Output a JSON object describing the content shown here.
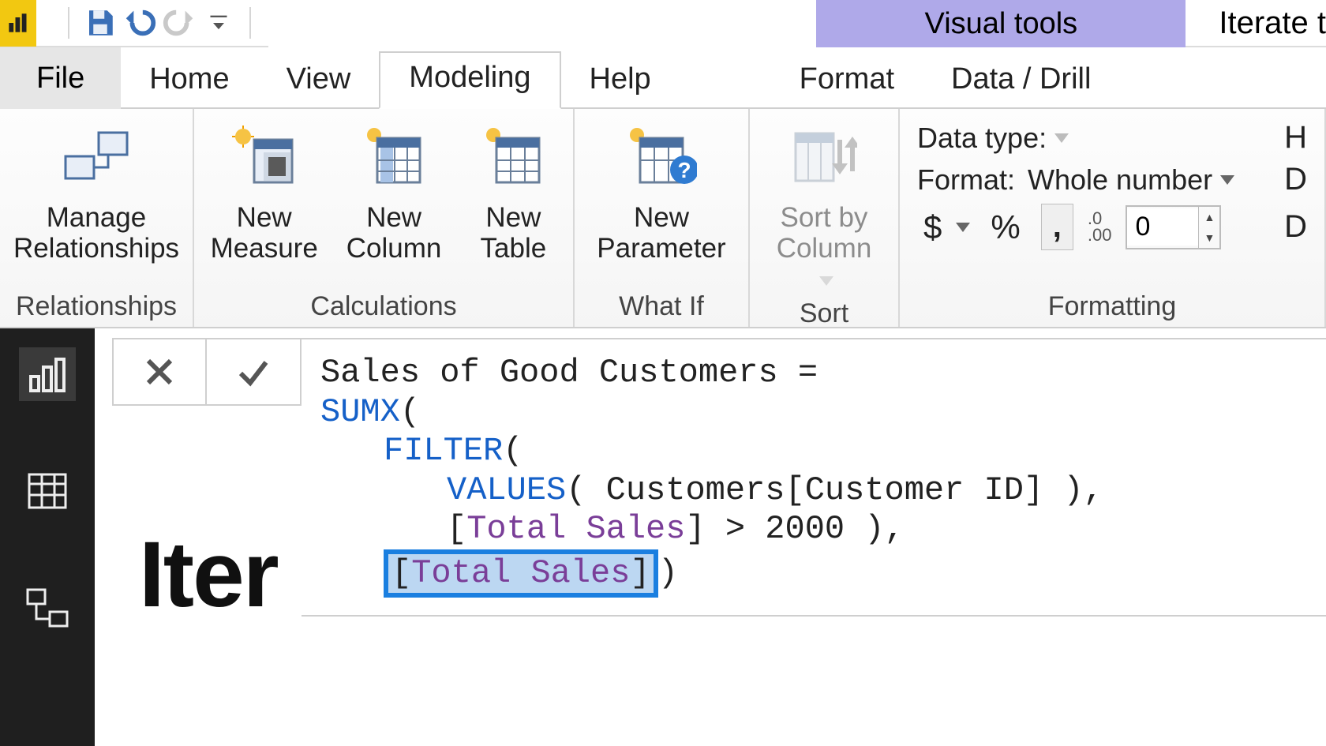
{
  "titlebar": {
    "visual_tools": "Visual tools",
    "doc_name": "Iterate t"
  },
  "tabs": {
    "file": "File",
    "home": "Home",
    "view": "View",
    "modeling": "Modeling",
    "help": "Help",
    "format": "Format",
    "data_drill": "Data / Drill"
  },
  "ribbon": {
    "relationships": {
      "manage": "Manage\nRelationships",
      "group": "Relationships"
    },
    "calculations": {
      "new_measure": "New\nMeasure",
      "new_column": "New\nColumn",
      "new_table": "New\nTable",
      "group": "Calculations"
    },
    "whatif": {
      "new_parameter": "New\nParameter",
      "group": "What If"
    },
    "sort": {
      "sort_by_column": "Sort by\nColumn",
      "group": "Sort"
    },
    "formatting": {
      "data_type_label": "Data type:",
      "format_label": "Format:",
      "format_value": "Whole number",
      "currency": "$",
      "percent": "%",
      "thousands": ",",
      "decimals_icon": ".0\n.00",
      "decimals_value": "0",
      "group": "Formatting",
      "edge_h": "H",
      "edge_d1": "D",
      "edge_d2": "D"
    }
  },
  "formula": {
    "line1_name": "Sales of Good Customers",
    "eq": " = ",
    "sumx": "SUMX",
    "filter": "FILTER",
    "values": "VALUES",
    "table_ref": " Customers[Customer ID] ),",
    "cond_open": "[",
    "total_sales": "Total Sales",
    "cond_rest": "] > 2000 ),",
    "sel_open": "[",
    "sel_close": "]",
    "close_paren": ")",
    "open_paren1": "(",
    "open_paren2": "("
  },
  "bg_text": "Iter"
}
